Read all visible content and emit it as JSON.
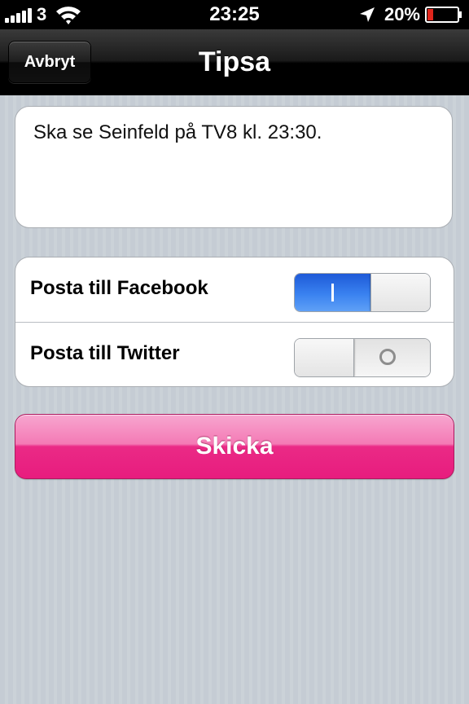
{
  "status_bar": {
    "carrier": "3",
    "time": "23:25",
    "battery_percent": "20%",
    "signal_bars": 5,
    "battery_level": 0.2,
    "icons": [
      "signal-icon",
      "wifi-icon",
      "location-arrow-icon",
      "battery-icon"
    ]
  },
  "nav": {
    "cancel_label": "Avbryt",
    "title": "Tipsa"
  },
  "message": {
    "text": "Ska se Seinfeld på TV8 kl. 23:30."
  },
  "options": [
    {
      "label": "Posta till Facebook",
      "on": true
    },
    {
      "label": "Posta till Twitter",
      "on": false
    }
  ],
  "send_label": "Skicka",
  "colors": {
    "accent_pink": "#e81c7e",
    "switch_blue": "#3a82f0",
    "battery_red": "#e0261c"
  }
}
